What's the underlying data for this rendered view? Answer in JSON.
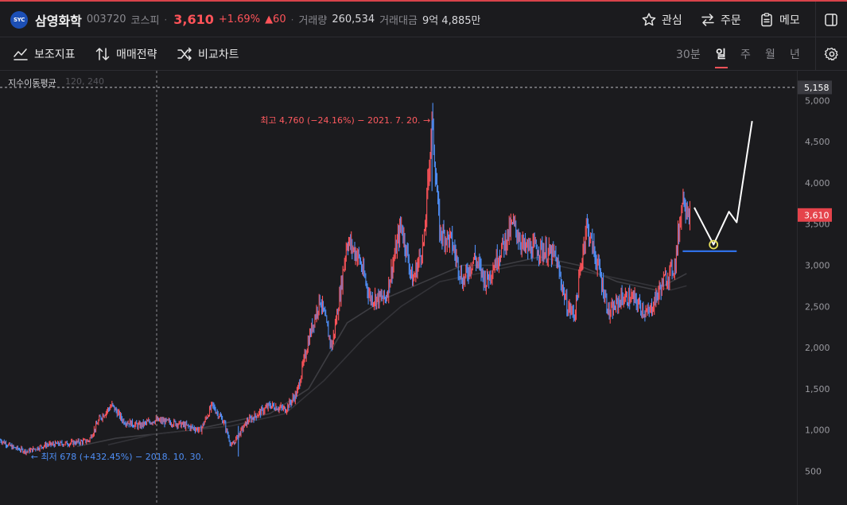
{
  "header": {
    "logo_text": "SYC",
    "name": "삼영화학",
    "code": "003720",
    "market": "코스피",
    "price": "3,610",
    "change_pct": "+1.69%",
    "change_abs": "▲60",
    "volume_label": "거래량",
    "volume": "260,534",
    "amount_label": "거래대금",
    "amount": "9억 4,885만",
    "separator": "·",
    "watch_label": "관심",
    "order_label": "주문",
    "memo_label": "메모"
  },
  "toolbar": {
    "indicator_label": "보조지표",
    "strategy_label": "매매전략",
    "compare_label": "비교차트",
    "periods": [
      "30분",
      "일",
      "주",
      "월",
      "년"
    ],
    "active_period": "일"
  },
  "chart": {
    "indicator_label": "지수이동평균",
    "indicator_params": "120, 240",
    "crosshair_price": "5,158",
    "current_price_tag": "3,610",
    "high_label": "최고 4,760 (−24.16%) − 2021. 7. 20. →",
    "low_label": "← 최저 678 (+432.45%) − 2018. 10. 30.",
    "colors": {
      "up": "#ff5359",
      "down": "#4f8ff7",
      "drawing": "#ffffff",
      "support": "#2f6fe6",
      "marker": "#e8e05a"
    }
  },
  "chart_data": {
    "type": "candlestick",
    "y_ticks": [
      500,
      1000,
      1500,
      2000,
      2500,
      3000,
      3500,
      4000,
      4500,
      5000
    ],
    "y_tick_labels": [
      "500",
      "1,000",
      "1,500",
      "2,000",
      "2,500",
      "3,000",
      "3,500",
      "4,000",
      "4,500",
      "5,000"
    ],
    "ylim": [
      90,
      5360
    ],
    "price_path": [
      [
        0,
        880
      ],
      [
        1.6,
        790
      ],
      [
        3.5,
        740
      ],
      [
        6,
        820
      ],
      [
        9,
        840
      ],
      [
        11.5,
        870
      ],
      [
        13,
        1150
      ],
      [
        14.5,
        1300
      ],
      [
        16,
        1110
      ],
      [
        18,
        1050
      ],
      [
        20,
        1120
      ],
      [
        23,
        1080
      ],
      [
        26,
        1000
      ],
      [
        27.5,
        1300
      ],
      [
        29,
        1100
      ],
      [
        30,
        800
      ],
      [
        32,
        1100
      ],
      [
        35,
        1300
      ],
      [
        37,
        1250
      ],
      [
        38.5,
        1450
      ],
      [
        40,
        2100
      ],
      [
        41.5,
        2600
      ],
      [
        43,
        2000
      ],
      [
        44,
        2600
      ],
      [
        45,
        3300
      ],
      [
        46.5,
        3100
      ],
      [
        48,
        2600
      ],
      [
        50,
        2600
      ],
      [
        52,
        3500
      ],
      [
        53.5,
        2800
      ],
      [
        55,
        3300
      ],
      [
        56,
        4760
      ],
      [
        57,
        3400
      ],
      [
        58.5,
        3300
      ],
      [
        60,
        2800
      ],
      [
        61.5,
        3100
      ],
      [
        63,
        2800
      ],
      [
        65,
        3200
      ],
      [
        66.5,
        3500
      ],
      [
        68,
        3200
      ],
      [
        70,
        3200
      ],
      [
        72,
        3100
      ],
      [
        73.5,
        2500
      ],
      [
        74.5,
        2400
      ],
      [
        76,
        3500
      ],
      [
        77.5,
        3000
      ],
      [
        79,
        2400
      ],
      [
        80.5,
        2600
      ],
      [
        82,
        2600
      ],
      [
        84,
        2400
      ],
      [
        86,
        2800
      ],
      [
        87.5,
        3000
      ],
      [
        88.5,
        3850
      ],
      [
        89.5,
        3610
      ]
    ],
    "ema_120": [
      [
        10,
        800
      ],
      [
        15,
        900
      ],
      [
        25,
        1000
      ],
      [
        35,
        1200
      ],
      [
        40,
        1500
      ],
      [
        45,
        2300
      ],
      [
        50,
        2600
      ],
      [
        55,
        2800
      ],
      [
        60,
        3000
      ],
      [
        65,
        3000
      ],
      [
        70,
        3100
      ],
      [
        75,
        3000
      ],
      [
        80,
        2800
      ],
      [
        85,
        2700
      ],
      [
        89,
        2900
      ]
    ],
    "ema_240": [
      [
        14,
        820
      ],
      [
        20,
        950
      ],
      [
        30,
        1050
      ],
      [
        37,
        1200
      ],
      [
        42,
        1600
      ],
      [
        47,
        2100
      ],
      [
        52,
        2500
      ],
      [
        57,
        2800
      ],
      [
        62,
        2900
      ],
      [
        67,
        3000
      ],
      [
        72,
        3000
      ],
      [
        77,
        2900
      ],
      [
        82,
        2800
      ],
      [
        87,
        2700
      ],
      [
        89,
        2750
      ]
    ],
    "high": {
      "value": 4760,
      "date": "2021. 7. 20."
    },
    "low": {
      "value": 678,
      "date": "2018. 10. 30."
    },
    "current": 3610,
    "projection": [
      [
        90,
        3700
      ],
      [
        92.5,
        3250
      ],
      [
        94.5,
        3650
      ],
      [
        95.5,
        3520
      ],
      [
        97.5,
        4750
      ]
    ],
    "support_level": 3170,
    "support_range": [
      88.5,
      95.5
    ],
    "marker_point": [
      92.5,
      3250
    ]
  }
}
